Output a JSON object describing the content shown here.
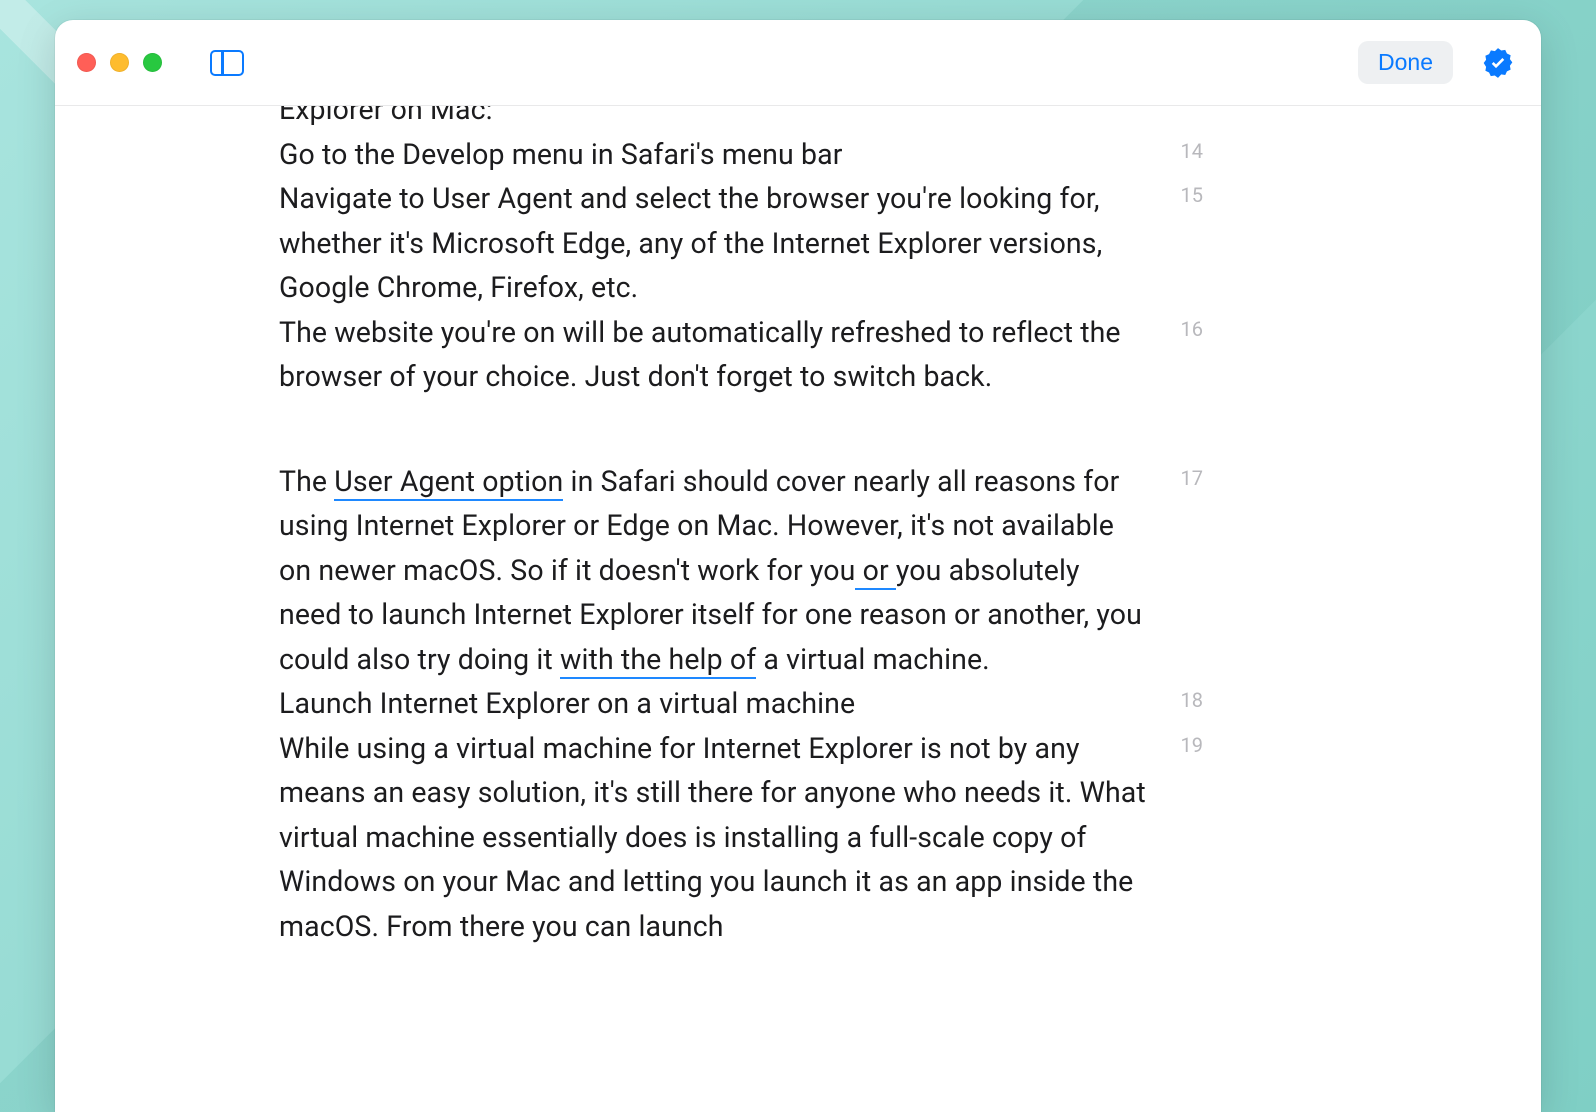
{
  "toolbar": {
    "done_label": "Done"
  },
  "paragraphs": [
    {
      "num": "",
      "text_html": "Explorer on Mac:",
      "cutoff": true
    },
    {
      "num": "14",
      "text_html": "Go to the Develop menu in Safari's menu bar"
    },
    {
      "num": "15",
      "text_html": "Navigate to User Agent and select the browser you're looking for, whether it's Microsoft Edge, any of the Internet Explorer versions, Google Chrome, Firefox, etc."
    },
    {
      "num": "16",
      "text_html": "The website you're on will be automatically refreshed to reflect the browser of your choice. Just don't forget to switch back."
    },
    {
      "gap": true
    },
    {
      "num": "17",
      "text_html": "The <span class=\"u-blue\">User Agent option</span> in Safari should cover nearly all reasons for using Internet Explorer or Edge on Mac. However, it's not available on newer macOS. So if it doesn't work for you<span class=\"u-blue\"> or </span>you absolutely need to launch Internet Explorer itself for one reason or another, you could also try doing it <span class=\"u-blue\">with the help of</span> a virtual machine.",
      "has_cursor": true
    },
    {
      "num": "18",
      "text_html": "Launch Internet Explorer on a virtual machine"
    },
    {
      "num": "19",
      "text_html": "While using a virtual machine for Internet Explorer is not by any means an easy solution, it's still there for anyone who needs it. What virtual machine essentially does is installing a full-scale copy of Windows on your Mac and letting you launch it as an app inside the macOS. From there you can launch"
    }
  ],
  "colors": {
    "accent": "#0a7aff",
    "underline": "#1e88ff",
    "line_num": "#b8b8bc"
  }
}
